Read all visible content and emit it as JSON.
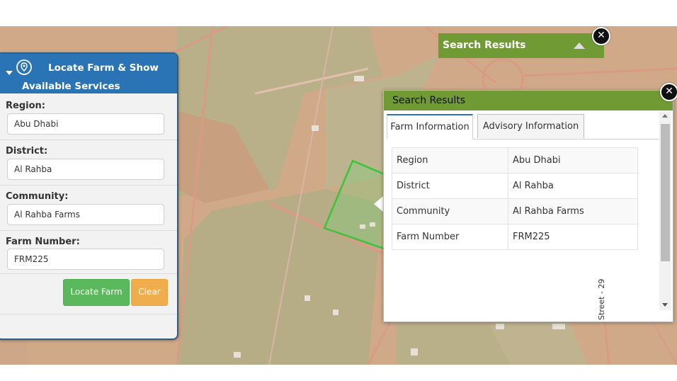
{
  "locate_panel": {
    "title_line1": "Locate Farm & Show",
    "title_line2": "Available Services",
    "fields": [
      {
        "label": "Region:",
        "value": "Abu Dhabi"
      },
      {
        "label": "District:",
        "value": "Al Rahba"
      },
      {
        "label": "Community:",
        "value": "Al Rahba Farms"
      },
      {
        "label": "Farm Number:",
        "value": "FRM225"
      }
    ],
    "locate_button": "Locate Farm",
    "clear_button": "Clear"
  },
  "search_bar": {
    "title": "Search Results"
  },
  "results": {
    "title": "Search Results",
    "tabs": [
      "Farm Information",
      "Advisory Information"
    ],
    "rows": [
      {
        "label": "Region",
        "value": "Abu Dhabi"
      },
      {
        "label": "District",
        "value": "Al Rahba"
      },
      {
        "label": "Community",
        "value": "Al Rahba Farms"
      },
      {
        "label": "Farm Number",
        "value": "FRM225"
      }
    ]
  },
  "map": {
    "street_label": "Street - 29"
  },
  "colors": {
    "panel_blue": "#2a74b5",
    "results_green": "#6f9a34",
    "farm_highlight": "#3ac43a",
    "locate_button": "#5cb85c",
    "clear_button": "#f0ad4e"
  },
  "icons": [
    "map-pin-icon",
    "collapse-arrow-icon",
    "close-icon",
    "expand-triangle-icon"
  ]
}
